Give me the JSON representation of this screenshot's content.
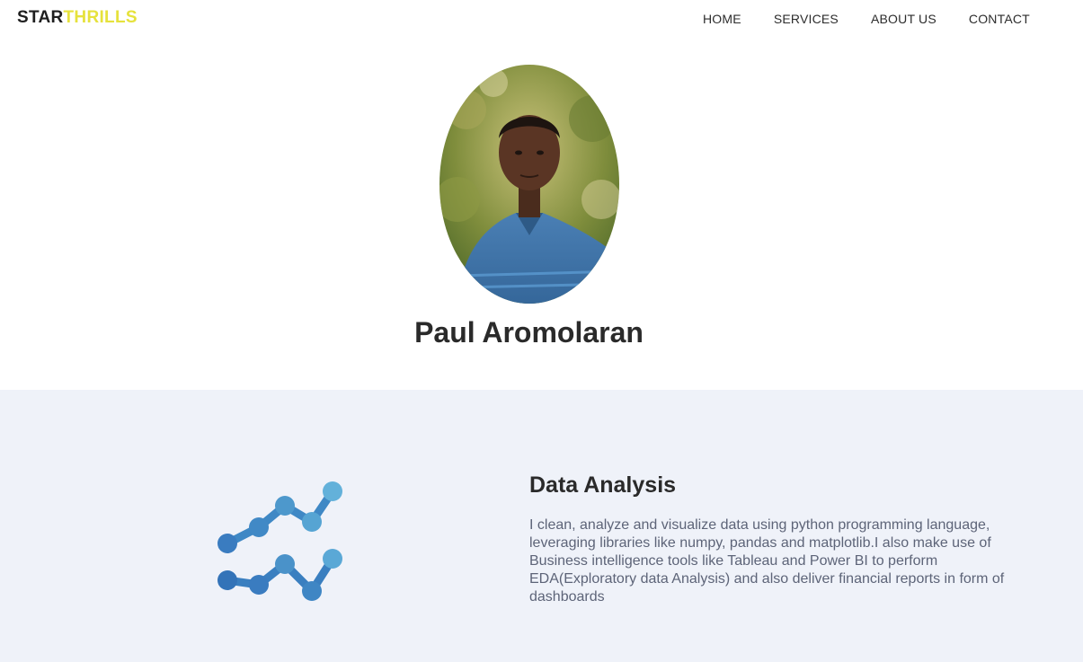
{
  "brand": {
    "part1": "STAR",
    "part2": "THRILLS",
    "color1": "#1f1f1f",
    "color2": "#e6e23c"
  },
  "nav": {
    "home": "HOME",
    "services": "SERVICES",
    "about": "ABOUT US",
    "contact": "CONTACT"
  },
  "profile": {
    "name": "Paul Aromolaran"
  },
  "service": {
    "icon": "line-chart-icon",
    "title": "Data Analysis",
    "description": "I clean, analyze and visualize data using python programming language, leveraging libraries like numpy, pandas and matplotlib.I also make use of Business intelligence tools like Tableau and Power BI to perform EDA(Exploratory data Analysis) and also deliver financial reports in form of dashboards"
  },
  "colors": {
    "section_bg": "#eff2f9",
    "icon_dark": "#3a7fc0",
    "icon_light": "#5fb0d8"
  }
}
